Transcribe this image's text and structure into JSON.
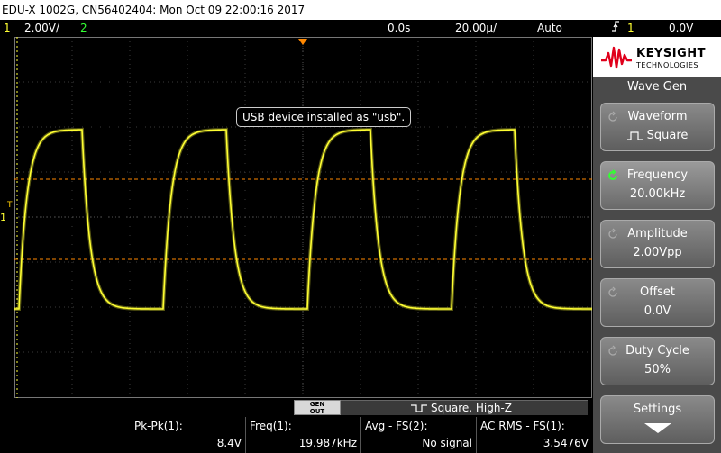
{
  "title_bar": "EDU-X 1002G, CN56402404: Mon Oct 09 22:00:16 2017",
  "status": {
    "ch1_num": "1",
    "ch1_scale": "2.00V/",
    "ch2_num": "2",
    "time_delay": "0.0s",
    "time_scale": "20.00µ/",
    "trigger_mode": "Auto",
    "trigger_icon": "trigger-edge-icon",
    "trigger_ch": "1",
    "trigger_level": "0.0V"
  },
  "message": "USB device installed as \"usb\".",
  "channel_marker": "1",
  "trigger_marker": "T",
  "wavegen_bar": {
    "button_line1": "GEN",
    "button_line2": "OUT",
    "info": "Square, High-Z"
  },
  "measurements": [
    {
      "label": "Pk-Pk(1):",
      "value": "8.4V"
    },
    {
      "label": "Freq(1):",
      "value": "19.987kHz"
    },
    {
      "label": "Avg - FS(2):",
      "value": "No signal"
    },
    {
      "label": "AC RMS - FS(1):",
      "value": "3.5476V"
    }
  ],
  "panel": {
    "brand": "KEYSIGHT",
    "brand_sub": "TECHNOLOGIES",
    "menu_title": "Wave Gen",
    "softkeys": [
      {
        "label": "Waveform",
        "value": "Square"
      },
      {
        "label": "Frequency",
        "value": "20.00kHz"
      },
      {
        "label": "Amplitude",
        "value": "2.00Vpp"
      },
      {
        "label": "Offset",
        "value": "0.0V"
      },
      {
        "label": "Duty Cycle",
        "value": "50%"
      },
      {
        "label": "Settings",
        "value": ""
      }
    ]
  },
  "colors": {
    "ch1": "#ffff33",
    "ch2": "#33ff33",
    "trigger_line": "#ff8800"
  }
}
